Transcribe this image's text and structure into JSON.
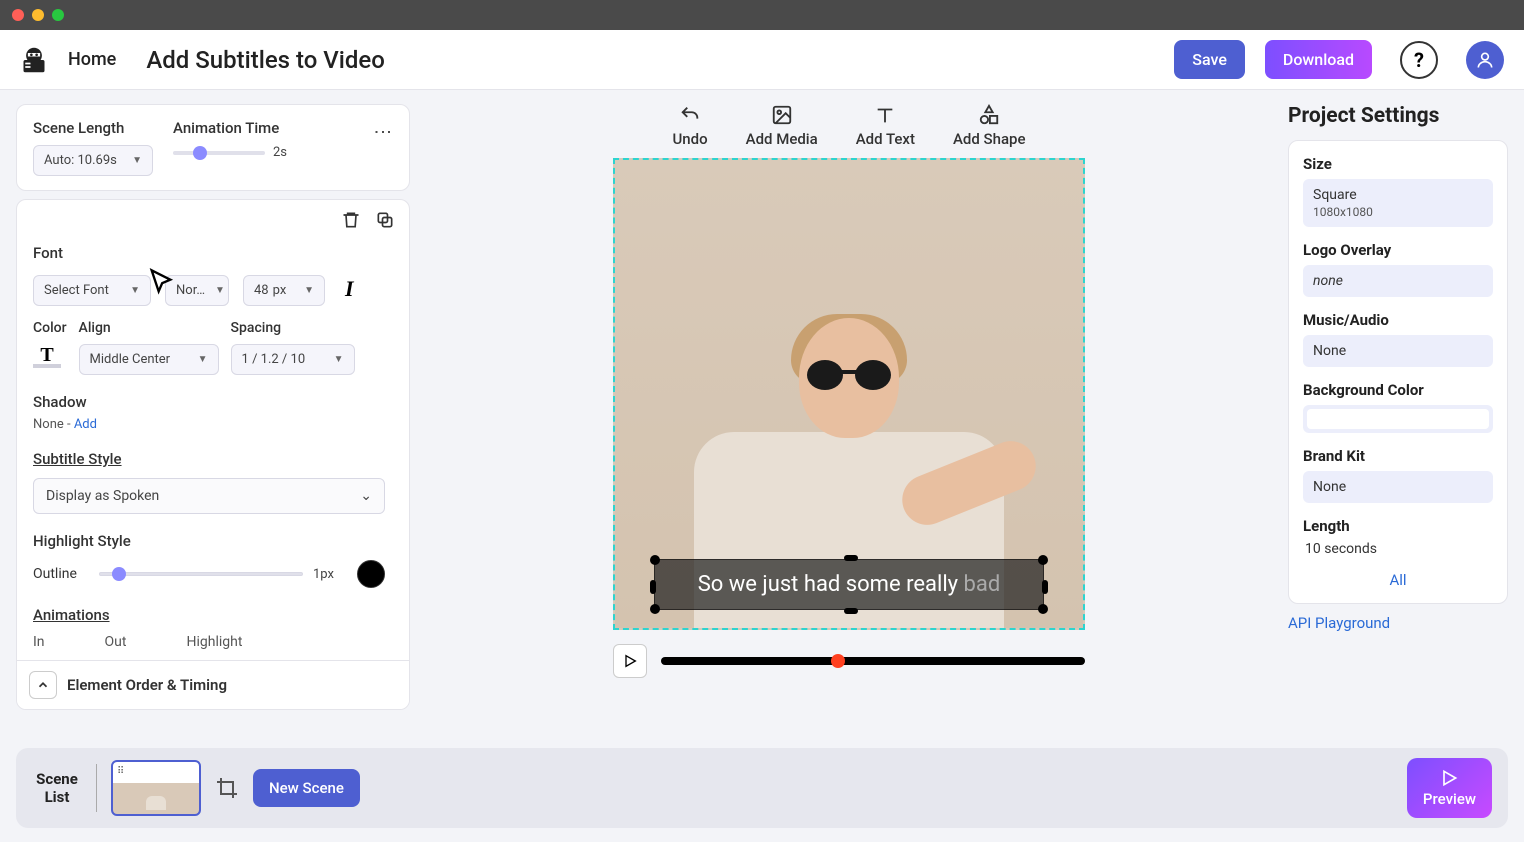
{
  "header": {
    "home": "Home",
    "title": "Add Subtitles to Video",
    "save": "Save",
    "download": "Download"
  },
  "sceneCard": {
    "lengthLabel": "Scene Length",
    "lengthValue": "Auto: 10.69s",
    "animLabel": "Animation Time",
    "animValue": "2s"
  },
  "fontCard": {
    "fontHead": "Font",
    "fontSelect": "Select Font",
    "weight": "Nor…",
    "sizeNum": "48",
    "sizeUnit": "px",
    "colorLabel": "Color",
    "alignLabel": "Align",
    "alignValue": "Middle Center",
    "spacingLabel": "Spacing",
    "spacingValue": "1 / 1.2 / 10",
    "shadowLabel": "Shadow",
    "shadowValue": "None - ",
    "shadowAdd": "Add",
    "subtitleStyleHead": "Subtitle Style",
    "subtitleStyleValue": "Display as Spoken",
    "highlightHead": "Highlight Style",
    "highlightLabel": "Outline",
    "highlightValue": "1px",
    "animHead": "Animations",
    "animIn": "In",
    "animOut": "Out",
    "animHighlight": "Highlight",
    "elementOrder": "Element Order & Timing"
  },
  "centerToolbar": {
    "undo": "Undo",
    "addMedia": "Add Media",
    "addText": "Add Text",
    "addShape": "Add Shape"
  },
  "subtitle": {
    "main": "So we just had some really ",
    "faded": "bad"
  },
  "rightPanel": {
    "title": "Project Settings",
    "sizeLabel": "Size",
    "sizeValue": "Square",
    "sizeSub": "1080x1080",
    "logoLabel": "Logo Overlay",
    "logoValue": "none",
    "musicLabel": "Music/Audio",
    "musicValue": "None",
    "bgLabel": "Background Color",
    "brandLabel": "Brand Kit",
    "brandValue": "None",
    "lengthLabel": "Length",
    "lengthValue": "10 seconds",
    "all": "All",
    "api": "API Playground"
  },
  "bottomBar": {
    "sceneList": "Scene List",
    "newScene": "New Scene",
    "preview": "Preview"
  }
}
